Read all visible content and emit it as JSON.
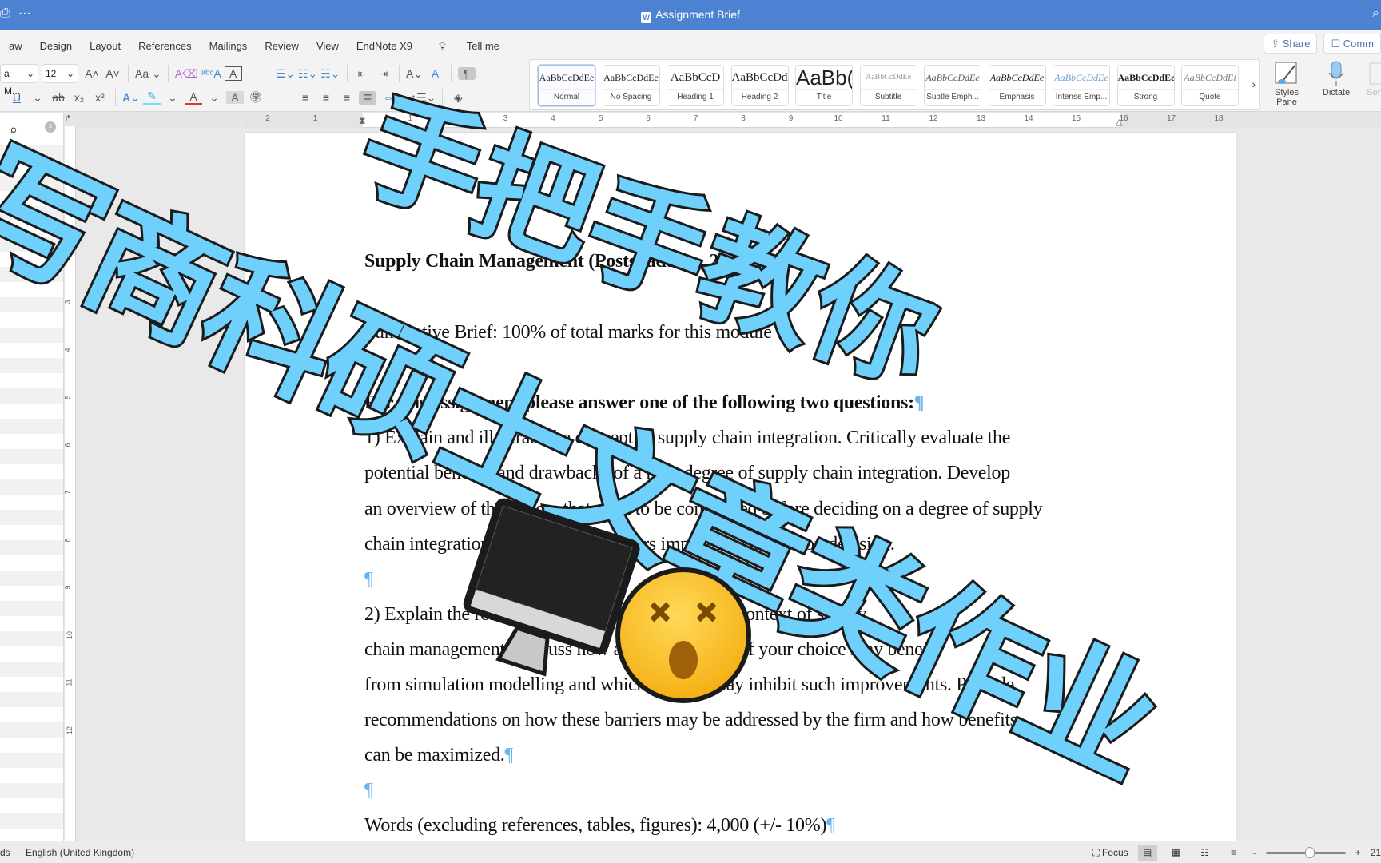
{
  "window": {
    "title": "Assignment Brief",
    "left_icons": [
      "print-icon",
      "more-icon"
    ]
  },
  "ribbon": {
    "tabs": [
      "aw",
      "Design",
      "Layout",
      "References",
      "Mailings",
      "Review",
      "View",
      "EndNote X9"
    ],
    "tell_me": "Tell me",
    "share_label": "Share",
    "comments_label": "Comm",
    "font_name": "a M...",
    "font_size": "12",
    "change_case": "Aa",
    "styles": [
      {
        "preview": "AaBbCcDdEe",
        "label": "Normal",
        "active": true
      },
      {
        "preview": "AaBbCcDdEe",
        "label": "No Spacing"
      },
      {
        "preview": "AaBbCcD",
        "label": "Heading 1"
      },
      {
        "preview": "AaBbCcDd",
        "label": "Heading 2"
      },
      {
        "preview": "AaBb(",
        "label": "Title"
      },
      {
        "preview": "AaBbCcDdEe",
        "label": "Subtitle"
      },
      {
        "preview": "AaBbCcDdEe",
        "label": "Subtle Emph..."
      },
      {
        "preview": "AaBbCcDdEe",
        "label": "Emphasis"
      },
      {
        "preview": "AaBbCcDdEe",
        "label": "Intense Emp..."
      },
      {
        "preview": "AaBbCcDdEe",
        "label": "Strong"
      },
      {
        "preview": "AaBbCcDdEi",
        "label": "Quote"
      }
    ],
    "styles_pane_label": "Styles Pane",
    "dictate_label": "Dictate",
    "sensitivity_label": "Sensi"
  },
  "ruler": {
    "numbers": [
      "2",
      "1",
      "1",
      "2",
      "3",
      "4",
      "5",
      "6",
      "7",
      "8",
      "9",
      "10",
      "11",
      "12",
      "13",
      "14",
      "15",
      "16",
      "17",
      "18"
    ],
    "vertical_numbers": [
      "1",
      "2",
      "3",
      "4",
      "5",
      "6",
      "7",
      "8",
      "9",
      "10",
      "11",
      "12"
    ]
  },
  "document": {
    "lines": [
      {
        "text": "Supply Chain Management (Postgraduate, 20 credits)",
        "bold": true,
        "pilcrow": false
      },
      {
        "text": "Summative Brief: 100% of total marks for this module",
        "bold": false,
        "pilcrow": false
      },
      {
        "text": "For this assignment please answer one of the following two questions:",
        "bold": true,
        "pilcrow": true
      },
      {
        "text": "1) Explain and illustrate the concept of supply chain integration. Critically evaluate the",
        "bold": false,
        "pilcrow": false
      },
      {
        "text": "potential benefits and drawbacks of a high degree of supply chain integration. Develop",
        "bold": false,
        "pilcrow": false
      },
      {
        "text": "an overview of the factors that need to be considered before deciding on a degree of supply",
        "bold": false,
        "pilcrow": false
      },
      {
        "text": "chain integration and how these factors impact the integration decision.",
        "bold": false,
        "pilcrow": false
      },
      {
        "text": "",
        "bold": false,
        "pilcrow": true
      },
      {
        "text": "2) Explain the role of simulation modelling in the context of supply",
        "bold": false,
        "pilcrow": false
      },
      {
        "text": "chain management. Discuss how a particular firm of your choice may benefit",
        "bold": false,
        "pilcrow": false
      },
      {
        "text": "from simulation modelling and which barriers may inhibit such improvements. Provide",
        "bold": false,
        "pilcrow": false
      },
      {
        "text": "recommendations on how these barriers may be addressed by the firm and how benefits",
        "bold": false,
        "pilcrow": false
      },
      {
        "text": "can be maximized.",
        "bold": false,
        "pilcrow": true
      },
      {
        "text": "",
        "bold": false,
        "pilcrow": true
      },
      {
        "text": "Words (excluding references, tables, figures): 4,000 (+/- 10%)",
        "bold": false,
        "pilcrow": true
      }
    ],
    "pilcrow": "¶"
  },
  "overlay": {
    "line1": "手把手教你",
    "line2": "写商科硕士文章类作业",
    "emoji_monitor": "computer-monitor",
    "emoji_face": "dizzy-face"
  },
  "statusbar": {
    "words": "ds",
    "language": "English (United Kingdom)",
    "focus_label": "Focus",
    "zoom_minus": "-",
    "zoom_plus": "+",
    "zoom_value": "21",
    "zoom_fraction": 0.55
  },
  "colors": {
    "titlebar": "#4d82d2",
    "overlay_fill": "#6fd0fb",
    "overlay_stroke": "#1b1b1b",
    "pilcrow": "#6ab4ef"
  }
}
